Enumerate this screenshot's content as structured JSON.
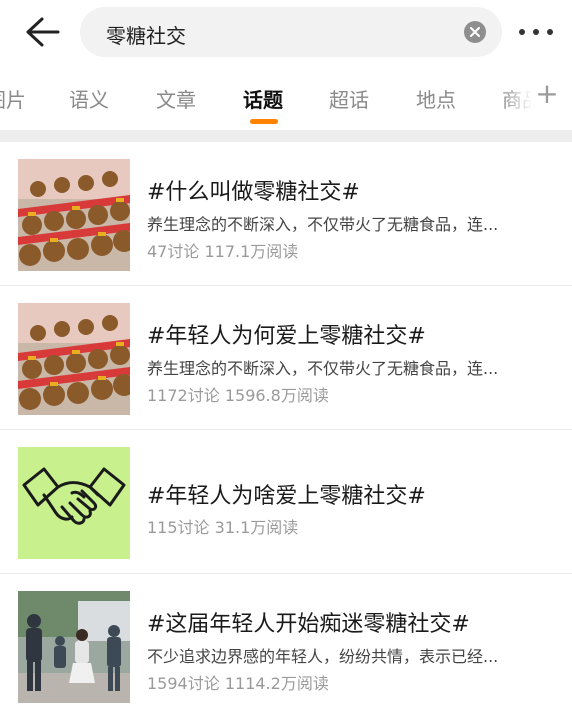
{
  "search": {
    "query": "零糖社交"
  },
  "icons": {
    "back": "back-arrow-icon",
    "clear": "clear-icon",
    "more": "more-dots-icon",
    "add": "plus-icon"
  },
  "tabs": [
    {
      "label": "图片"
    },
    {
      "label": "语义"
    },
    {
      "label": "文章"
    },
    {
      "label": "话题",
      "active": true
    },
    {
      "label": "超话"
    },
    {
      "label": "地点"
    },
    {
      "label": "商品"
    }
  ],
  "accent_color": "#ff8200",
  "topics": [
    {
      "title": "#什么叫做零糖社交#",
      "desc": "养生理念的不断深入，不仅带火了无糖食品，连...",
      "discussions": "47讨论",
      "reads": "117.1万阅读",
      "thumb": "capybara-plush-display"
    },
    {
      "title": "#年轻人为何爱上零糖社交#",
      "desc": "养生理念的不断深入，不仅带火了无糖食品，连...",
      "discussions": "1172讨论",
      "reads": "1596.8万阅读",
      "thumb": "capybara-plush-display"
    },
    {
      "title": "#年轻人为啥爱上零糖社交#",
      "desc": "",
      "discussions": "115讨论",
      "reads": "31.1万阅读",
      "thumb": "handshake-illustration"
    },
    {
      "title": "#这届年轻人开始痴迷零糖社交#",
      "desc": "不少追求边界感的年轻人，纷纷共情，表示已经...",
      "discussions": "1594讨论",
      "reads": "1114.2万阅读",
      "thumb": "people-walking-photo"
    }
  ]
}
